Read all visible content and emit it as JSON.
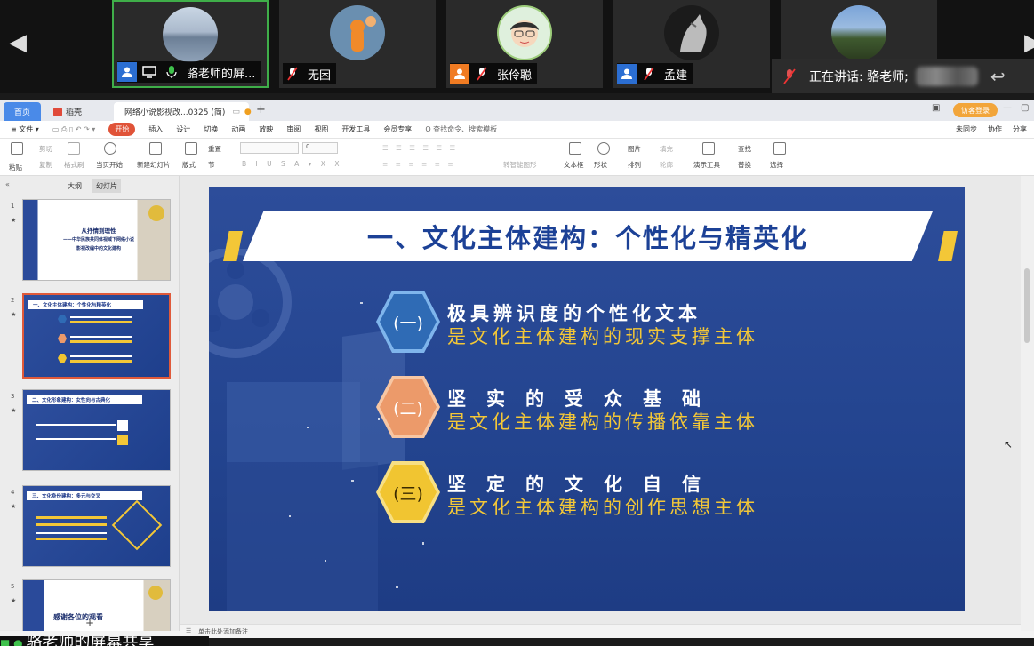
{
  "conference": {
    "tiles": [
      {
        "name": "骆老师的屏...",
        "badge_color": "#2b6ed2",
        "mic": "on",
        "active": true
      },
      {
        "name": "无困",
        "badge_color": "",
        "mic": "muted",
        "active": false
      },
      {
        "name": "张伶聪",
        "badge_color": "#f07b22",
        "mic": "muted",
        "active": false
      },
      {
        "name": "孟建",
        "badge_color": "#2b6ed2",
        "mic": "muted",
        "active": false
      },
      {
        "name": "",
        "badge_color": "",
        "mic": "",
        "active": false
      }
    ],
    "speaking_label": "正在讲话: 骆老师;",
    "left_arrow": "◀",
    "right_arrow": "▶"
  },
  "wps": {
    "tabs": {
      "home": "首页",
      "daoke": "稻壳",
      "doc": "网络小说影视改...0325 (简)"
    },
    "login": "访客登录",
    "menu": [
      "≡ 文件 ▾",
      "开始",
      "插入",
      "设计",
      "切换",
      "动画",
      "放映",
      "审阅",
      "视图",
      "开发工具",
      "会员专享",
      "Q 查找命令、搜索模板"
    ],
    "menu_right": [
      "未同步",
      "协作",
      "分享"
    ],
    "ribbon": {
      "paste": "粘贴",
      "copy": "复制",
      "format_painter": "格式刷",
      "cut": "剪切",
      "play_from_current": "当页开始",
      "new_slide": "新建幻灯片",
      "layout": "版式",
      "section": "节",
      "reset": "重置",
      "font_size": "0",
      "text_box": "文本框",
      "shape": "形状",
      "arrange": "排列",
      "picture": "图片",
      "fill": "填充",
      "outline": "轮廓",
      "presentation_tools": "演示工具",
      "find": "查找",
      "replace": "替换",
      "select": "选择",
      "convert_smartart": "转智能图形"
    },
    "sidebar": {
      "tab_outline": "大纲",
      "tab_slides": "幻灯片",
      "slides": [
        {
          "num": "1",
          "title_lines": [
            "从抒情到理性",
            "——中华民族共同体视域下网络小说",
            "影视改编中的文化建构"
          ]
        },
        {
          "num": "2",
          "title": "一、文化主体建构：个性化与精英化"
        },
        {
          "num": "3",
          "title": "二、文化形象建构：女性向与古典化"
        },
        {
          "num": "4",
          "title": "三、文化身份建构：多元与交叉"
        },
        {
          "num": "5",
          "title": "感谢各位的观看"
        }
      ]
    },
    "notes_placeholder": "单击此处添加备注"
  },
  "slide": {
    "title": "一、文化主体建构：个性化与精英化",
    "points": [
      {
        "badge": "(一)",
        "line1": "极具辨识度的个性化文本",
        "line2": "是文化主体建构的现实支撑主体",
        "color_outer": "#7fb5ec",
        "color_inner": "#2f6bb5"
      },
      {
        "badge": "(二)",
        "line1": "坚　实　的　受　众　基　础",
        "line2": "是文化主体建构的传播依靠主体",
        "color_outer": "#f7c6a3",
        "color_inner": "#ec9a6a"
      },
      {
        "badge": "(三)",
        "line1": "坚　定　的　文　化　自　信",
        "line2": "是文化主体建构的创作思想主体",
        "color_outer": "#f7df84",
        "color_inner": "#f1c531"
      }
    ],
    "accent_yellow": "#f3c737",
    "title_color": "#1c4196",
    "bg_color": "#244690"
  },
  "share_text": "骆老师的屏幕共享"
}
